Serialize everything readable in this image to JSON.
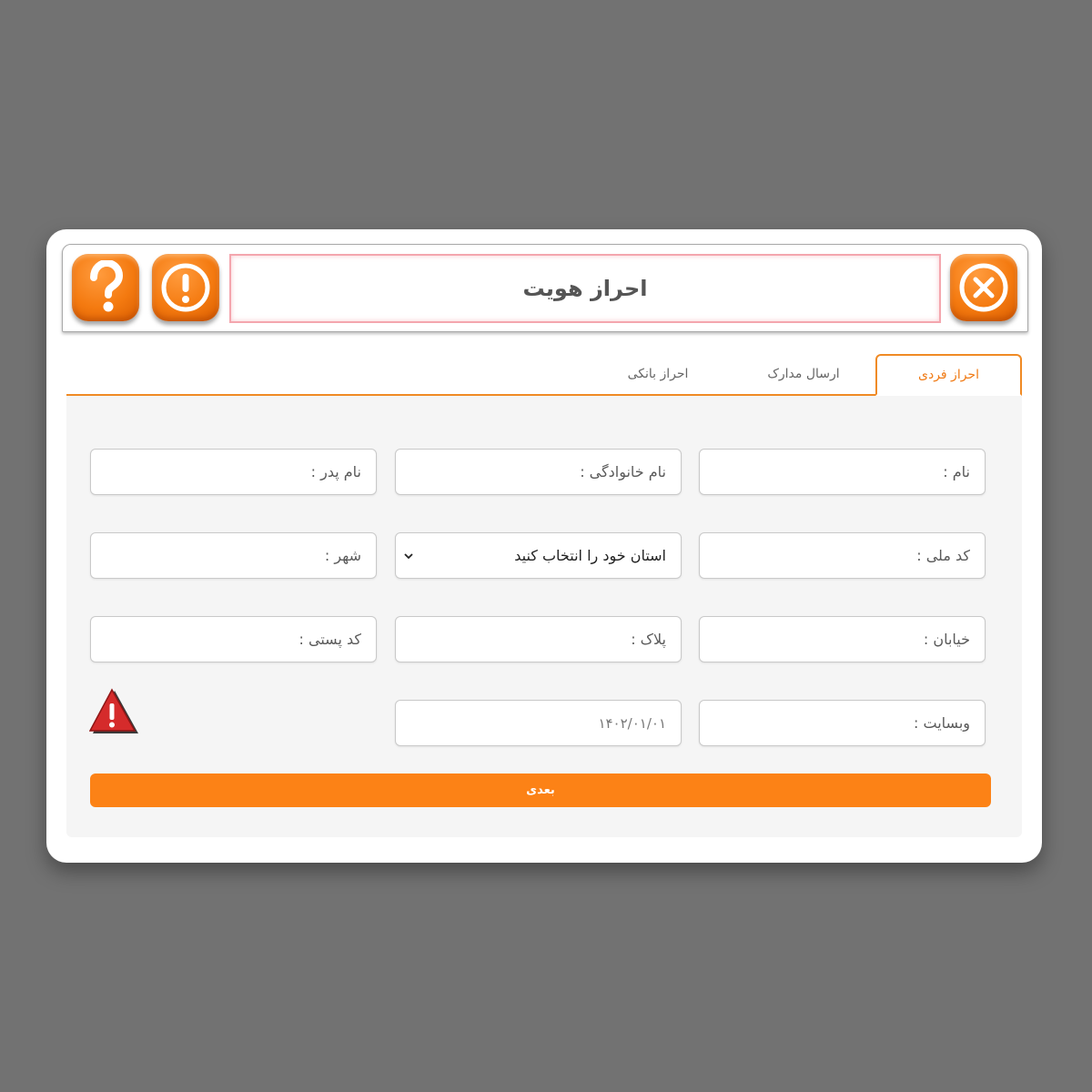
{
  "header": {
    "title": "احراز هویت",
    "icons": [
      "help-icon",
      "info-icon",
      "close-icon"
    ]
  },
  "tabs": [
    {
      "label": "احراز فردی",
      "active": true
    },
    {
      "label": "ارسال مدارک",
      "active": false
    },
    {
      "label": "احراز بانکی",
      "active": false
    }
  ],
  "form": {
    "first_name": "نام :",
    "last_name": "نام خانوادگی :",
    "father_name": "نام پدر :",
    "national_code": "کد ملی :",
    "province": "استان خود را انتخاب کنید",
    "city": "شهر :",
    "street": "خیابان :",
    "plaque": "پلاک :",
    "postal_code": "کد پستی :",
    "website": "وبسایت :",
    "date": "۱۴۰۲/۰۱/۰۱"
  },
  "actions": {
    "next_label": "بعدی"
  },
  "colors": {
    "accent": "#fc8216",
    "background": "#727272",
    "warning": "#d32f2f"
  }
}
